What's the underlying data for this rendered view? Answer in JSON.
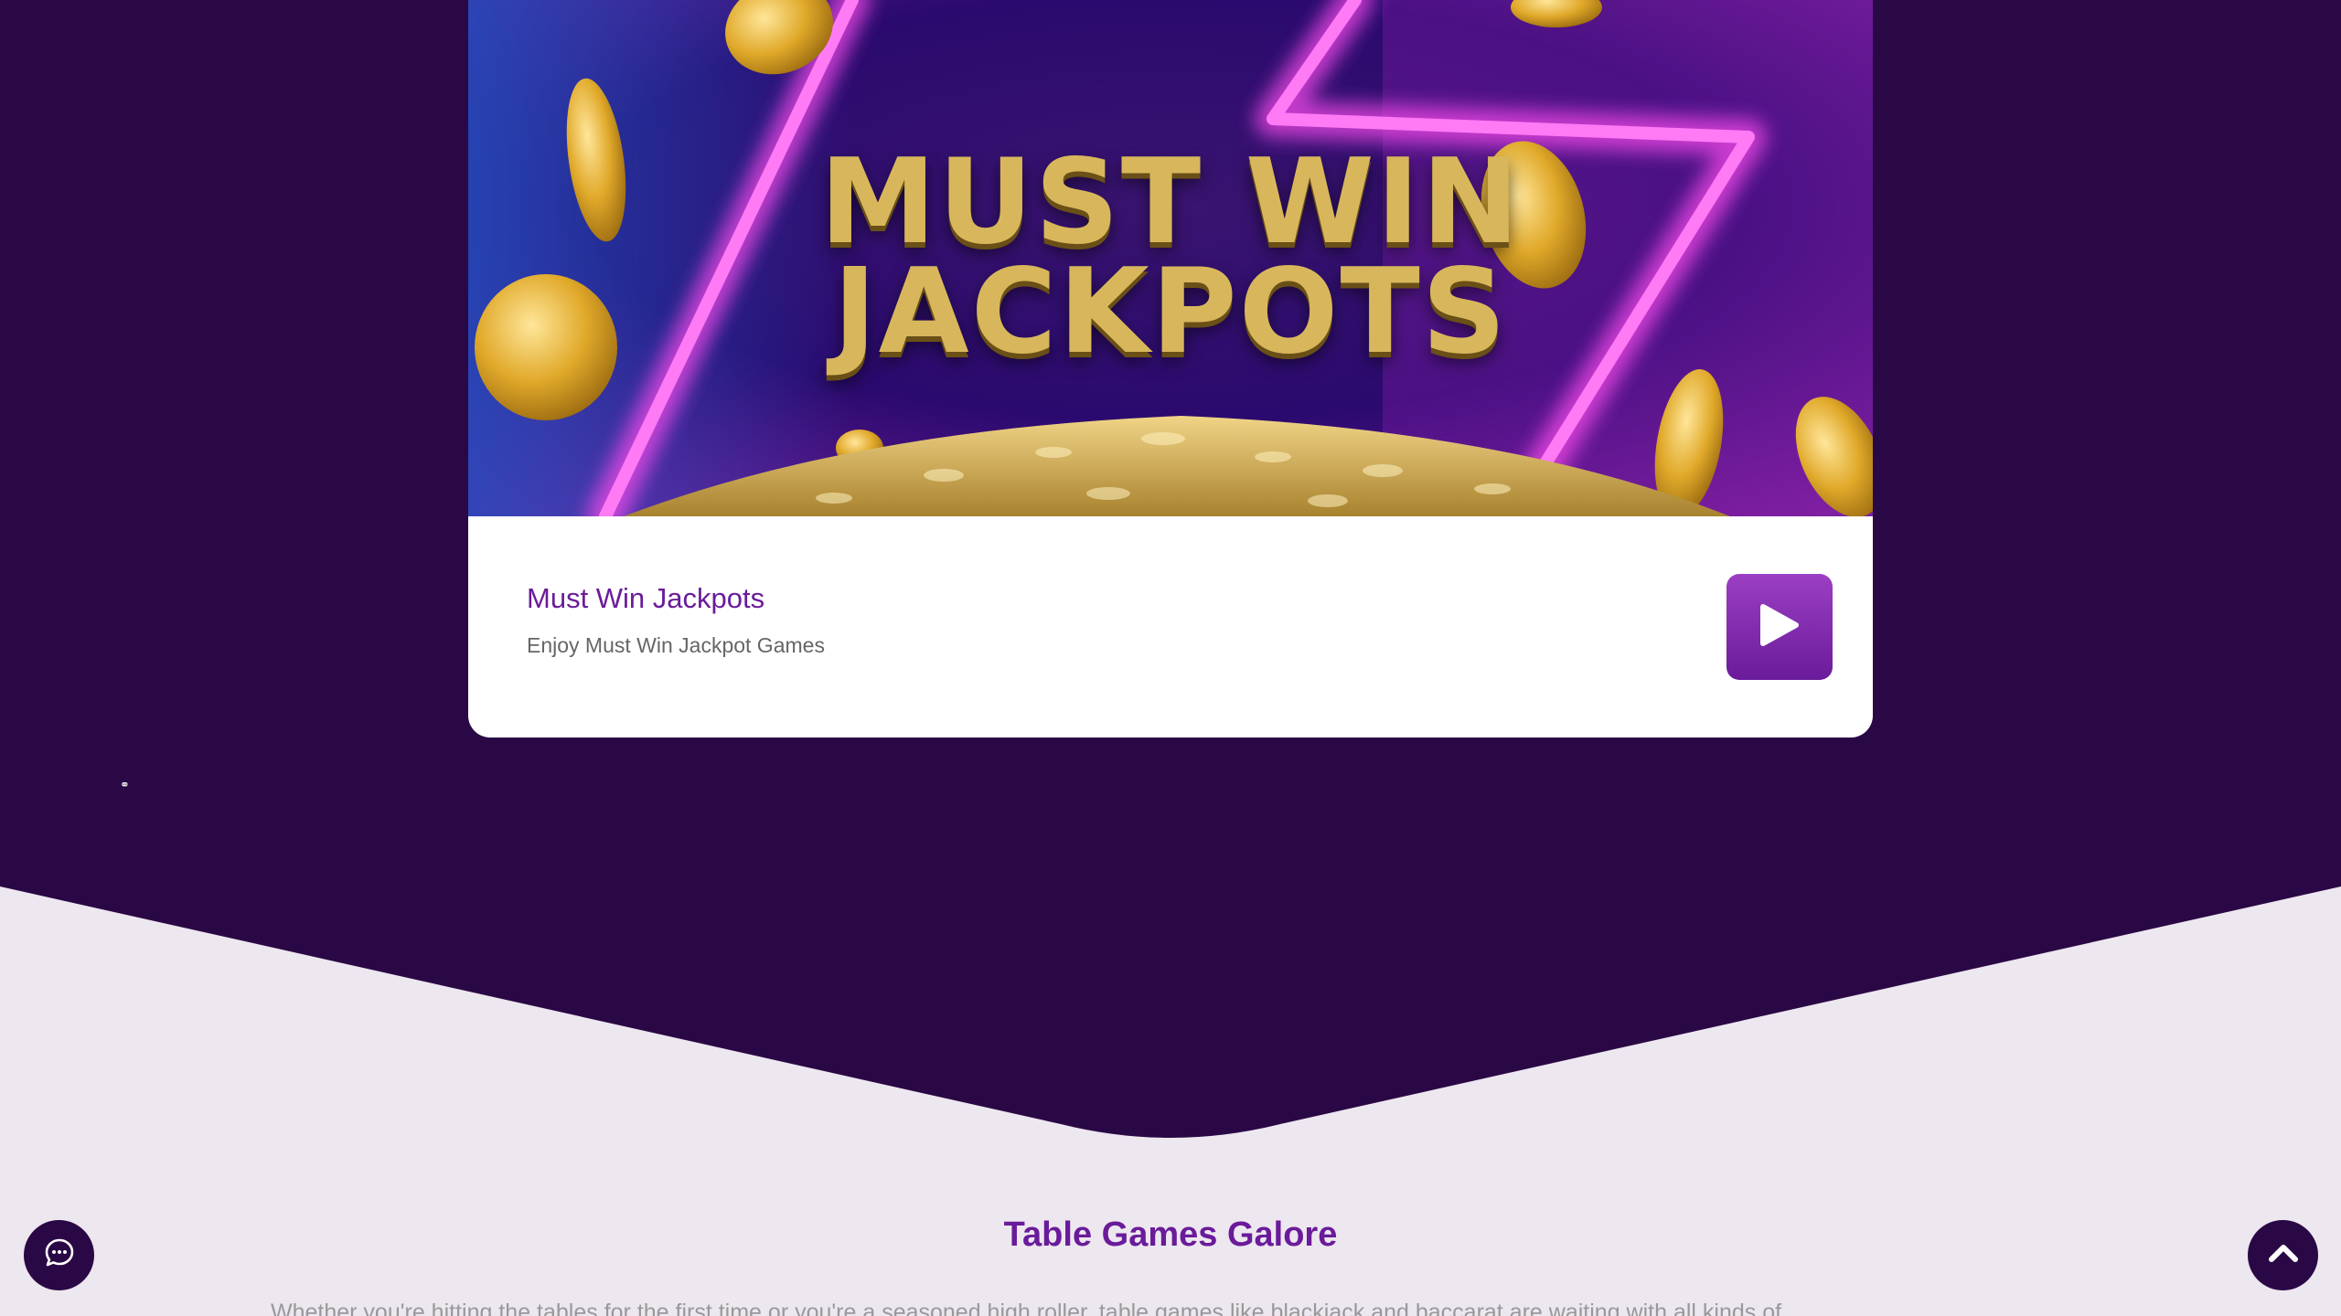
{
  "promo_card": {
    "banner_line_1": "MUST WIN",
    "banner_line_2": "JACKPOTS",
    "title": "Must Win Jackpots",
    "subtitle": "Enjoy Must Win Jackpot Games",
    "play_icon": "play-icon"
  },
  "section": {
    "heading": "Table Games Galore",
    "intro_text": "Whether you're hitting the tables for the first time or you're a seasoned high roller, table games like blackjack and baccarat are waiting with all kinds of"
  },
  "floating": {
    "chat_icon": "chat-bubble-icon",
    "top_icon": "chevron-up-icon"
  },
  "colors": {
    "dark_purple": "#2a0845",
    "brand_purple": "#6a1b9a",
    "page_background": "#ede7ef",
    "gold": "#d8b75c",
    "neon_pink": "#ff4df0"
  }
}
